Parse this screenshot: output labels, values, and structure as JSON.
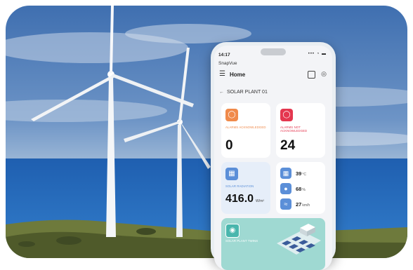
{
  "status": {
    "time": "14:17",
    "icons": "••• ◔ ▬"
  },
  "app": {
    "name": "SnapVue"
  },
  "nav": {
    "menu_icon": "menu-icon",
    "title": "Home",
    "scan_icon": "scan-icon",
    "bell_icon": "bell-icon"
  },
  "breadcrumb": {
    "back": "←",
    "label": "SOLAR PLANT 01"
  },
  "cards": {
    "alarms_ack": {
      "label": "ALARMS ACKNOWLEDGED",
      "value": "0",
      "icon": "shield-icon",
      "color": "#f08a4b"
    },
    "alarms_not_ack": {
      "label": "ALARMS NOT ACKNOWLEDGED",
      "value": "24",
      "icon": "shield-icon",
      "color": "#e4374f"
    },
    "radiation": {
      "label": "SOLAR RADIATION",
      "value": "416.0",
      "unit": "W/m²",
      "icon": "radiation-icon"
    },
    "weather": {
      "temperature": {
        "value": "39",
        "unit": "°C",
        "icon": "thermometer-icon"
      },
      "humidity": {
        "value": "68",
        "unit": "%",
        "icon": "droplet-icon"
      },
      "wind": {
        "value": "27",
        "unit": "km/h",
        "icon": "wind-icon"
      }
    },
    "twin": {
      "label": "SOLAR PLANT TWINS",
      "icon": "eye-icon"
    }
  }
}
